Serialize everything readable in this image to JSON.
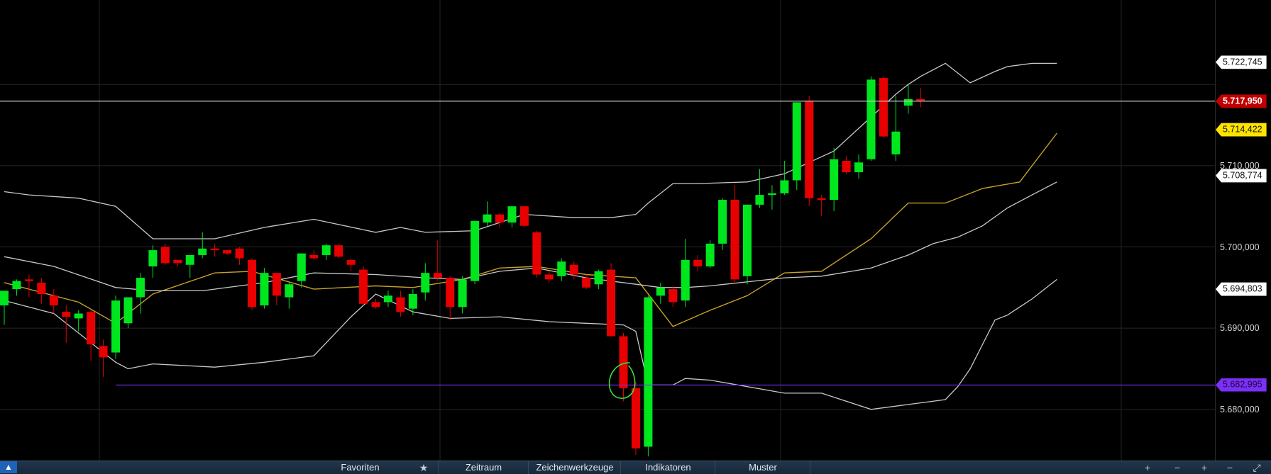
{
  "chart_data": {
    "type": "candlestick",
    "title": "",
    "xlabel": "",
    "ylabel": "",
    "ylim": [
      5.6737,
      5.7304
    ],
    "y_ticks": [
      "5.710,000",
      "5.700,000",
      "5.690,000",
      "5.680,000"
    ],
    "y_tick_values": [
      5.71,
      5.7,
      5.69,
      5.68
    ],
    "price_tags": [
      {
        "label": "5.722,745",
        "value": 5.722745,
        "style": "white"
      },
      {
        "label": "5.717,950",
        "value": 5.71795,
        "style": "red"
      },
      {
        "label": "5.714,422",
        "value": 5.714422,
        "style": "yellow"
      },
      {
        "label": "5.708,774",
        "value": 5.708774,
        "style": "white"
      },
      {
        "label": "5.694,803",
        "value": 5.694803,
        "style": "white"
      },
      {
        "label": "5.682,995",
        "value": 5.682995,
        "style": "purple"
      }
    ],
    "horizontal_lines": [
      {
        "name": "current-price-line",
        "value": 5.71795,
        "color": "#c8c8c8"
      },
      {
        "name": "support-line",
        "value": 5.682995,
        "color": "#7b2ff7"
      }
    ],
    "candles": [
      {
        "o": 5.6928,
        "h": 5.6944,
        "l": 5.6904,
        "c": 5.6946,
        "up": true
      },
      {
        "o": 5.6948,
        "h": 5.696,
        "l": 5.694,
        "c": 5.6958,
        "up": true
      },
      {
        "o": 5.696,
        "h": 5.6966,
        "l": 5.6938,
        "c": 5.6958,
        "up": false
      },
      {
        "o": 5.6956,
        "h": 5.6962,
        "l": 5.693,
        "c": 5.6942,
        "up": false
      },
      {
        "o": 5.694,
        "h": 5.6948,
        "l": 5.6918,
        "c": 5.6928,
        "up": false
      },
      {
        "o": 5.692,
        "h": 5.6928,
        "l": 5.6882,
        "c": 5.6914,
        "up": false
      },
      {
        "o": 5.6912,
        "h": 5.6922,
        "l": 5.6896,
        "c": 5.6918,
        "up": true
      },
      {
        "o": 5.692,
        "h": 5.6922,
        "l": 5.686,
        "c": 5.688,
        "up": false
      },
      {
        "o": 5.6878,
        "h": 5.6886,
        "l": 5.684,
        "c": 5.6864,
        "up": false
      },
      {
        "o": 5.687,
        "h": 5.694,
        "l": 5.6862,
        "c": 5.6934,
        "up": true
      },
      {
        "o": 5.6906,
        "h": 5.6938,
        "l": 5.69,
        "c": 5.6938,
        "up": true
      },
      {
        "o": 5.6938,
        "h": 5.6968,
        "l": 5.6918,
        "c": 5.6962,
        "up": true
      },
      {
        "o": 5.6996,
        "h": 5.7002,
        "l": 5.6962,
        "c": 5.6976,
        "up": true
      },
      {
        "o": 5.7,
        "h": 5.7004,
        "l": 5.6978,
        "c": 5.698,
        "up": false
      },
      {
        "o": 5.6984,
        "h": 5.6984,
        "l": 5.6976,
        "c": 5.698,
        "up": false
      },
      {
        "o": 5.6978,
        "h": 5.699,
        "l": 5.6962,
        "c": 5.699,
        "up": true
      },
      {
        "o": 5.699,
        "h": 5.7018,
        "l": 5.6986,
        "c": 5.6998,
        "up": true
      },
      {
        "o": 5.6998,
        "h": 5.7004,
        "l": 5.6988,
        "c": 5.6996,
        "up": false
      },
      {
        "o": 5.6996,
        "h": 5.6996,
        "l": 5.699,
        "c": 5.6992,
        "up": false
      },
      {
        "o": 5.6998,
        "h": 5.7,
        "l": 5.6978,
        "c": 5.6986,
        "up": false
      },
      {
        "o": 5.6984,
        "h": 5.6986,
        "l": 5.6922,
        "c": 5.6926,
        "up": false
      },
      {
        "o": 5.6928,
        "h": 5.6974,
        "l": 5.6924,
        "c": 5.6968,
        "up": true
      },
      {
        "o": 5.6968,
        "h": 5.6968,
        "l": 5.6928,
        "c": 5.694,
        "up": false
      },
      {
        "o": 5.6938,
        "h": 5.6956,
        "l": 5.6924,
        "c": 5.6954,
        "up": true
      },
      {
        "o": 5.6958,
        "h": 5.6992,
        "l": 5.695,
        "c": 5.6992,
        "up": true
      },
      {
        "o": 5.699,
        "h": 5.6996,
        "l": 5.6984,
        "c": 5.6986,
        "up": false
      },
      {
        "o": 5.699,
        "h": 5.7004,
        "l": 5.6984,
        "c": 5.7002,
        "up": true
      },
      {
        "o": 5.7002,
        "h": 5.7004,
        "l": 5.6986,
        "c": 5.6988,
        "up": false
      },
      {
        "o": 5.6984,
        "h": 5.6986,
        "l": 5.697,
        "c": 5.6978,
        "up": false
      },
      {
        "o": 5.6972,
        "h": 5.6976,
        "l": 5.6928,
        "c": 5.693,
        "up": false
      },
      {
        "o": 5.6932,
        "h": 5.6936,
        "l": 5.6924,
        "c": 5.6926,
        "up": false
      },
      {
        "o": 5.6932,
        "h": 5.6946,
        "l": 5.6926,
        "c": 5.694,
        "up": true
      },
      {
        "o": 5.6938,
        "h": 5.6946,
        "l": 5.6914,
        "c": 5.692,
        "up": false
      },
      {
        "o": 5.6924,
        "h": 5.6948,
        "l": 5.6916,
        "c": 5.6942,
        "up": true
      },
      {
        "o": 5.6944,
        "h": 5.698,
        "l": 5.6934,
        "c": 5.6968,
        "up": true
      },
      {
        "o": 5.6968,
        "h": 5.7008,
        "l": 5.6958,
        "c": 5.6962,
        "up": false
      },
      {
        "o": 5.6962,
        "h": 5.6964,
        "l": 5.691,
        "c": 5.6926,
        "up": false
      },
      {
        "o": 5.6926,
        "h": 5.6964,
        "l": 5.6918,
        "c": 5.696,
        "up": true
      },
      {
        "o": 5.6958,
        "h": 5.7032,
        "l": 5.6954,
        "c": 5.7032,
        "up": true
      },
      {
        "o": 5.703,
        "h": 5.7056,
        "l": 5.7026,
        "c": 5.704,
        "up": true
      },
      {
        "o": 5.704,
        "h": 5.7042,
        "l": 5.7024,
        "c": 5.703,
        "up": false
      },
      {
        "o": 5.703,
        "h": 5.705,
        "l": 5.7024,
        "c": 5.705,
        "up": true
      },
      {
        "o": 5.705,
        "h": 5.705,
        "l": 5.7024,
        "c": 5.7026,
        "up": false
      },
      {
        "o": 5.7018,
        "h": 5.702,
        "l": 5.6962,
        "c": 5.6966,
        "up": false
      },
      {
        "o": 5.6966,
        "h": 5.697,
        "l": 5.6956,
        "c": 5.696,
        "up": false
      },
      {
        "o": 5.6964,
        "h": 5.6986,
        "l": 5.6958,
        "c": 5.6982,
        "up": true
      },
      {
        "o": 5.6978,
        "h": 5.6982,
        "l": 5.696,
        "c": 5.6966,
        "up": false
      },
      {
        "o": 5.6962,
        "h": 5.6966,
        "l": 5.6948,
        "c": 5.695,
        "up": false
      },
      {
        "o": 5.6954,
        "h": 5.6972,
        "l": 5.6948,
        "c": 5.697,
        "up": true
      },
      {
        "o": 5.6972,
        "h": 5.698,
        "l": 5.689,
        "c": 5.689,
        "up": false
      },
      {
        "o": 5.689,
        "h": 5.6894,
        "l": 5.681,
        "c": 5.6826,
        "up": false
      },
      {
        "o": 5.6826,
        "h": 5.6834,
        "l": 5.6744,
        "c": 5.6752,
        "up": false
      },
      {
        "o": 5.6754,
        "h": 5.694,
        "l": 5.6742,
        "c": 5.6938,
        "up": true
      },
      {
        "o": 5.694,
        "h": 5.6956,
        "l": 5.693,
        "c": 5.695,
        "up": true
      },
      {
        "o": 5.6948,
        "h": 5.6952,
        "l": 5.6926,
        "c": 5.6932,
        "up": false
      },
      {
        "o": 5.6934,
        "h": 5.701,
        "l": 5.6926,
        "c": 5.6984,
        "up": true
      },
      {
        "o": 5.6984,
        "h": 5.699,
        "l": 5.697,
        "c": 5.6976,
        "up": false
      },
      {
        "o": 5.6976,
        "h": 5.7008,
        "l": 5.6974,
        "c": 5.7004,
        "up": true
      },
      {
        "o": 5.7004,
        "h": 5.706,
        "l": 5.6996,
        "c": 5.7058,
        "up": true
      },
      {
        "o": 5.7058,
        "h": 5.7076,
        "l": 5.6954,
        "c": 5.696,
        "up": false
      },
      {
        "o": 5.6964,
        "h": 5.7052,
        "l": 5.6954,
        "c": 5.7052,
        "up": true
      },
      {
        "o": 5.7052,
        "h": 5.7096,
        "l": 5.7048,
        "c": 5.7064,
        "up": true
      },
      {
        "o": 5.7064,
        "h": 5.7076,
        "l": 5.7046,
        "c": 5.7066,
        "up": true
      },
      {
        "o": 5.7066,
        "h": 5.7106,
        "l": 5.7064,
        "c": 5.7082,
        "up": true
      },
      {
        "o": 5.7082,
        "h": 5.7178,
        "l": 5.707,
        "c": 5.7178,
        "up": true
      },
      {
        "o": 5.718,
        "h": 5.7186,
        "l": 5.705,
        "c": 5.706,
        "up": false
      },
      {
        "o": 5.706,
        "h": 5.7064,
        "l": 5.7038,
        "c": 5.7058,
        "up": false
      },
      {
        "o": 5.7058,
        "h": 5.7122,
        "l": 5.7044,
        "c": 5.7108,
        "up": true
      },
      {
        "o": 5.7106,
        "h": 5.7112,
        "l": 5.709,
        "c": 5.7092,
        "up": false
      },
      {
        "o": 5.7092,
        "h": 5.7114,
        "l": 5.7084,
        "c": 5.7104,
        "up": true
      },
      {
        "o": 5.7108,
        "h": 5.721,
        "l": 5.7106,
        "c": 5.7206,
        "up": true
      },
      {
        "o": 5.7208,
        "h": 5.721,
        "l": 5.7134,
        "c": 5.7136,
        "up": false
      },
      {
        "o": 5.7114,
        "h": 5.7186,
        "l": 5.7106,
        "c": 5.7142,
        "up": true
      },
      {
        "o": 5.7174,
        "h": 5.72,
        "l": 5.7164,
        "c": 5.7182,
        "up": true
      },
      {
        "o": 5.7182,
        "h": 5.7196,
        "l": 5.7172,
        "c": 5.718,
        "up": false
      }
    ],
    "series": [
      {
        "name": "",
        "role": "moving-average",
        "color": "#c9a227",
        "x": [
          0,
          6,
          9,
          12,
          17,
          20,
          25,
          30,
          33,
          37,
          40,
          43,
          47,
          51,
          54,
          57,
          60,
          63,
          66,
          70,
          73,
          76,
          79,
          82,
          85
        ],
        "values": [
          5.6956,
          5.6932,
          5.6906,
          5.6942,
          5.6968,
          5.697,
          5.6948,
          5.6952,
          5.695,
          5.696,
          5.6974,
          5.6976,
          5.6966,
          5.6962,
          5.6902,
          5.6922,
          5.694,
          5.6968,
          5.697,
          5.701,
          5.7054,
          5.7054,
          5.7072,
          5.708,
          5.714
        ]
      },
      {
        "name": "",
        "role": "band-outer-upper",
        "color": "#c8c8c8",
        "x": [
          0,
          2,
          6,
          9,
          12,
          17,
          21,
          25,
          30,
          32,
          34,
          38,
          42,
          46,
          49,
          51,
          52,
          54,
          56,
          60,
          63,
          67,
          70,
          72,
          73,
          74,
          76,
          78,
          80,
          81,
          82,
          83,
          85
        ],
        "values": [
          5.7068,
          5.7064,
          5.706,
          5.705,
          5.701,
          5.701,
          5.7024,
          5.7034,
          5.7018,
          5.7024,
          5.7018,
          5.702,
          5.704,
          5.7036,
          5.7036,
          5.704,
          5.7054,
          5.7078,
          5.7078,
          5.708,
          5.709,
          5.7118,
          5.716,
          5.7188,
          5.72,
          5.721,
          5.7226,
          5.7202,
          5.7216,
          5.7222,
          5.7224,
          5.7226,
          5.7226
        ]
      },
      {
        "name": "",
        "role": "band-inner-upper",
        "color": "#c8c8c8",
        "x": [
          0,
          4,
          9,
          12,
          16,
          21,
          25,
          30,
          34,
          37,
          40,
          43,
          47,
          51,
          53,
          55,
          57,
          63,
          66,
          70,
          73,
          75,
          77,
          79,
          81,
          83,
          85
        ],
        "values": [
          5.6988,
          5.6976,
          5.695,
          5.6946,
          5.6946,
          5.6956,
          5.6968,
          5.6966,
          5.6962,
          5.696,
          5.697,
          5.6974,
          5.6962,
          5.6954,
          5.695,
          5.695,
          5.6952,
          5.6962,
          5.6964,
          5.6974,
          5.699,
          5.7004,
          5.7012,
          5.7026,
          5.7048,
          5.7064,
          5.708
        ]
      },
      {
        "name": "",
        "role": "band-inner-lower",
        "color": "#c8c8c8",
        "x": [
          0,
          4,
          9,
          10,
          12,
          17,
          21,
          25,
          28,
          30,
          33,
          36,
          40,
          44,
          47,
          50,
          51,
          52,
          54,
          55,
          57,
          63,
          66,
          70,
          73,
          76,
          77,
          78,
          80,
          81,
          82,
          83,
          85
        ],
        "values": [
          5.6934,
          5.6918,
          5.6858,
          5.685,
          5.6856,
          5.6852,
          5.6858,
          5.6866,
          5.6914,
          5.6942,
          5.692,
          5.6912,
          5.6914,
          5.6908,
          5.6906,
          5.6904,
          5.6896,
          5.683,
          5.683,
          5.6838,
          5.6836,
          5.682,
          5.682,
          5.68,
          5.6806,
          5.6812,
          5.6828,
          5.685,
          5.691,
          5.6916,
          5.6926,
          5.6936,
          5.696
        ]
      },
      {
        "name": "",
        "role": "band-outer-lower",
        "color": "#c8c8c8"
      }
    ],
    "annotations": [
      {
        "type": "circle",
        "label": "",
        "at_candle": 50,
        "value": 5.6833,
        "color": "#3ddc3d"
      }
    ],
    "grid": true,
    "legend": "none"
  },
  "toolbar": {
    "items": [
      {
        "label": "Favoriten"
      },
      {
        "label": "Zeitraum"
      },
      {
        "label": "Zeichenwerkzeuge"
      },
      {
        "label": "Indikatoren"
      },
      {
        "label": "Muster"
      }
    ],
    "star_icon": "star-icon",
    "right_icons": [
      "plus-icon",
      "minus-icon",
      "minus-icon",
      "plus-icon",
      "expand-icon",
      "collapse-icon"
    ],
    "corner_icon": "chevron-up-icon"
  },
  "colors": {
    "background": "#000000",
    "bull": "#00e61e",
    "bear": "#e80000",
    "grid": "#262626",
    "band": "#c8c8c8",
    "ma": "#c9a227",
    "toolbar": "#1c2e42"
  }
}
